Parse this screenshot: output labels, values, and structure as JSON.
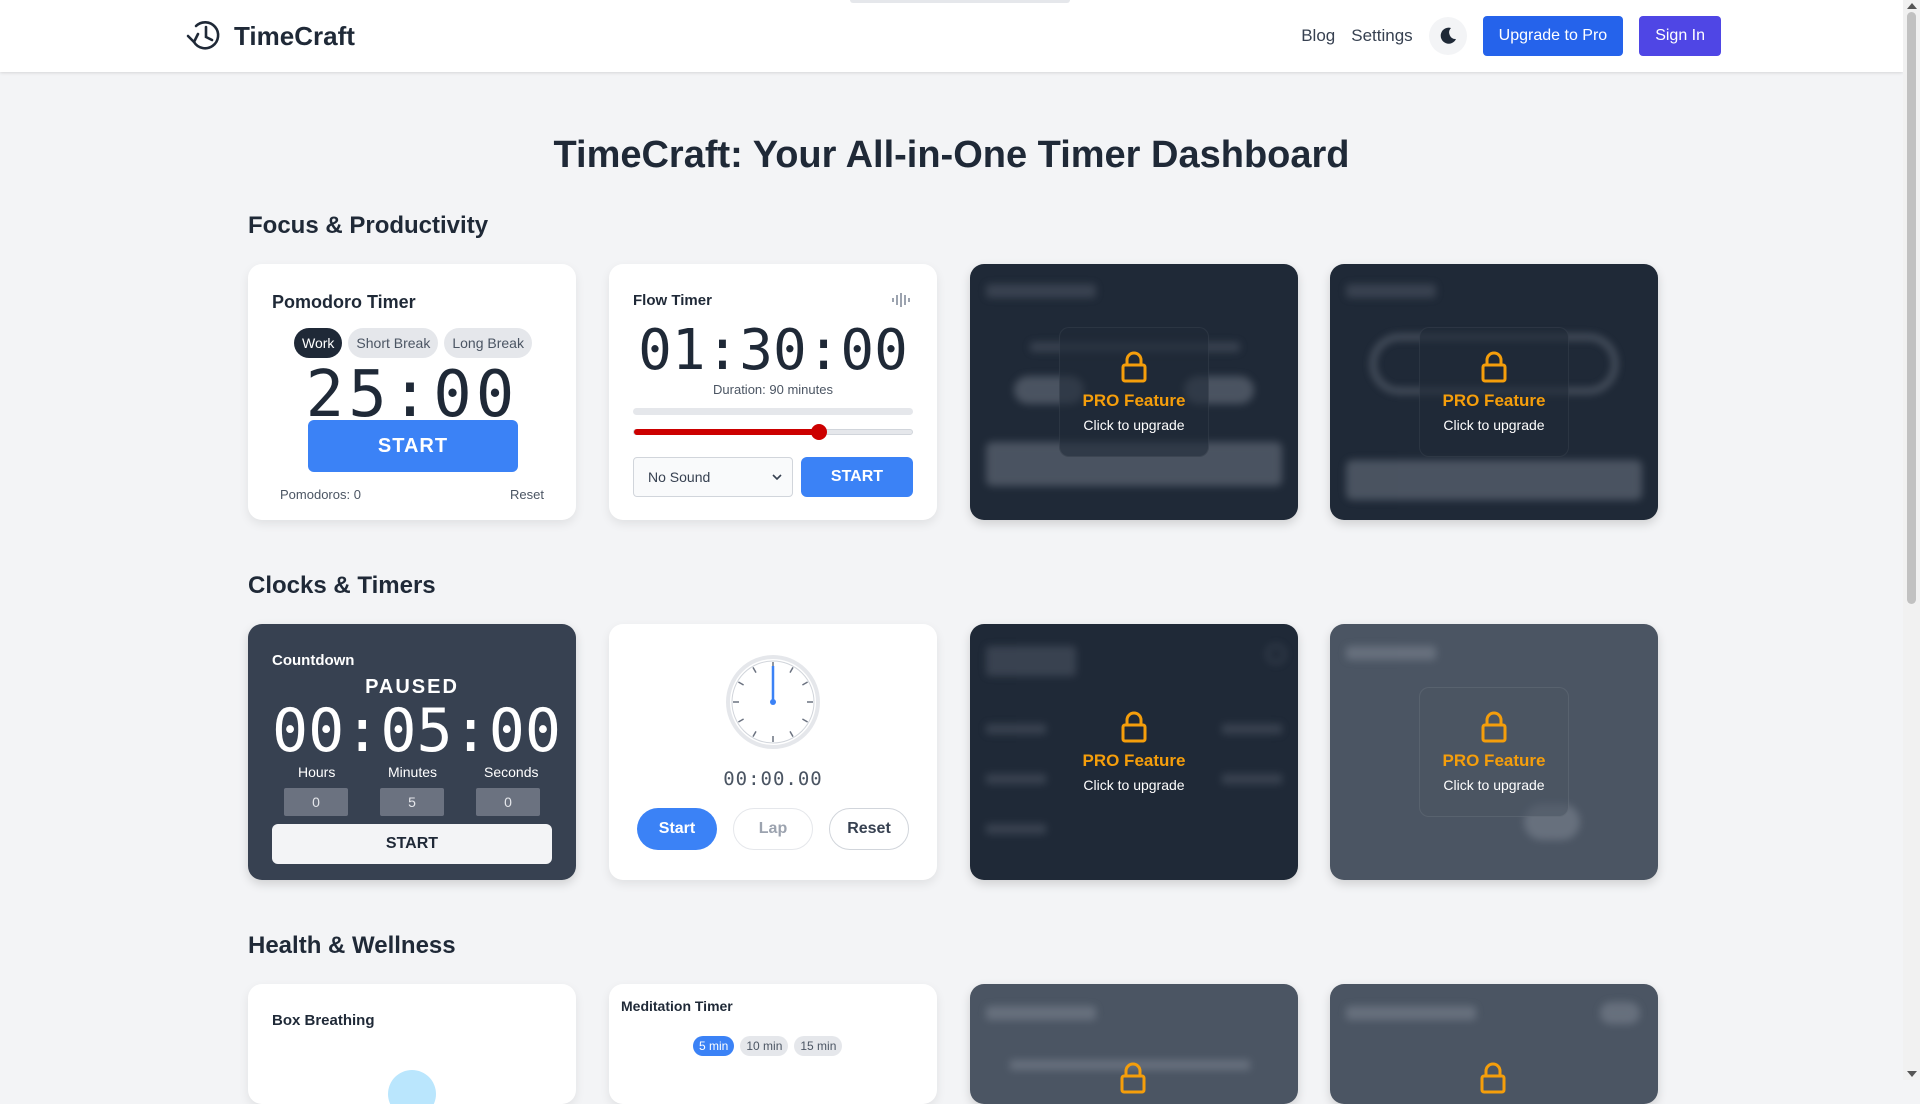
{
  "header": {
    "logo_text": "TimeCraft",
    "nav": {
      "blog": "Blog",
      "settings": "Settings"
    },
    "upgrade_label": "Upgrade to Pro",
    "signin_label": "Sign In"
  },
  "page_title": "TimeCraft: Your All-in-One Timer Dashboard",
  "sections": {
    "focus": "Focus & Productivity",
    "clocks": "Clocks & Timers",
    "health": "Health & Wellness"
  },
  "pomodoro": {
    "title": "Pomodoro Timer",
    "modes": [
      "Work",
      "Short Break",
      "Long Break"
    ],
    "time": "25:00",
    "start_label": "START",
    "count_label": "Pomodoros: 0",
    "reset_label": "Reset"
  },
  "flow": {
    "title": "Flow Timer",
    "time": "01:30:00",
    "duration_label": "Duration: 90 minutes",
    "slider_fraction": 0.66,
    "sound_value": "No Sound",
    "start_label": "START"
  },
  "pro": {
    "title": "PRO Feature",
    "subtitle": "Click to upgrade"
  },
  "countdown": {
    "title": "Countdown",
    "status": "PAUSED",
    "time": "00:05:00",
    "labels": [
      "Hours",
      "Minutes",
      "Seconds"
    ],
    "inputs": [
      "0",
      "5",
      "0"
    ],
    "start_label": "START"
  },
  "stopwatch": {
    "time": "00:00.00",
    "start_label": "Start",
    "lap_label": "Lap",
    "reset_label": "Reset"
  },
  "box_breathing": {
    "title": "Box Breathing"
  },
  "meditation": {
    "title": "Meditation Timer",
    "options": [
      "5 min",
      "10 min",
      "15 min"
    ]
  },
  "colors": {
    "primary": "#3b82f6",
    "upgrade": "#2563eb",
    "signin": "#4f46e5",
    "pro_accent": "#f59e0b",
    "slider": "#cc0000"
  }
}
